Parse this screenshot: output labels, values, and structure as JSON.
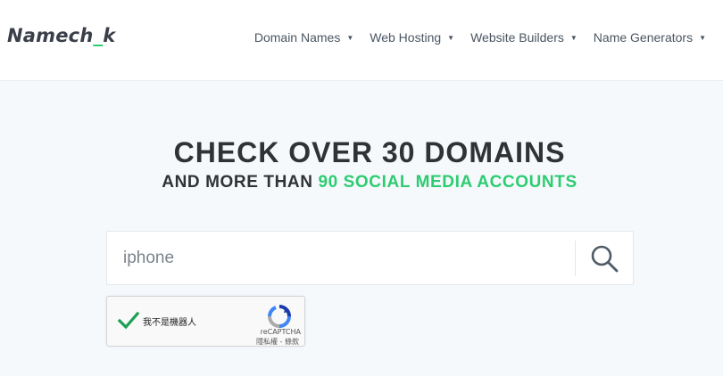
{
  "header": {
    "logo": {
      "text_start": "Namech",
      "underscore": "_",
      "text_end": "k"
    },
    "nav": [
      {
        "label": "Domain Names"
      },
      {
        "label": "Web Hosting"
      },
      {
        "label": "Website Builders"
      },
      {
        "label": "Name Generators"
      }
    ],
    "caret_glyph": "▼"
  },
  "hero": {
    "title_light": "CHECK OVER ",
    "title_bold": "30 DOMAINS",
    "subtitle_start": "AND MORE THAN ",
    "subtitle_accent": "90 SOCIAL MEDIA ACCOUNTS"
  },
  "search": {
    "value": "iphone",
    "icon": "search-icon"
  },
  "recaptcha": {
    "label": "我不是機器人",
    "brand": "reCAPTCHA",
    "links": "隱私權 - 條款",
    "checked": true
  },
  "colors": {
    "accent": "#2ecc71",
    "text_dark": "#2f3336",
    "page_bg": "#f5f9fc"
  }
}
